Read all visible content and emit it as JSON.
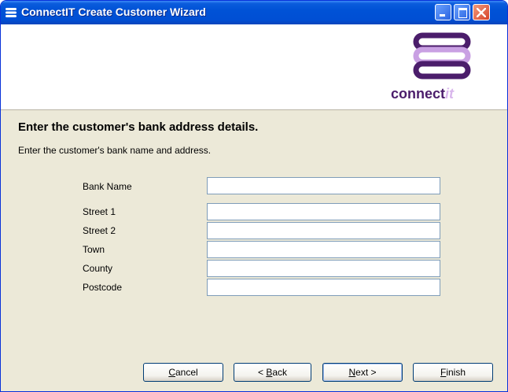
{
  "window": {
    "title": "ConnectIT Create Customer Wizard"
  },
  "logo": {
    "text_main": "connect",
    "text_accent": "it"
  },
  "page": {
    "heading": "Enter the customer's bank address details.",
    "subtext": "Enter the customer's bank name and address."
  },
  "form": {
    "bank_name_label": "Bank Name",
    "bank_name_value": "",
    "street1_label": "Street 1",
    "street1_value": "",
    "street2_label": "Street 2",
    "street2_value": "",
    "town_label": "Town",
    "town_value": "",
    "county_label": "County",
    "county_value": "",
    "postcode_label": "Postcode",
    "postcode_value": ""
  },
  "buttons": {
    "cancel_key": "C",
    "cancel_rest": "ancel",
    "back_prefix": "< ",
    "back_key": "B",
    "back_rest": "ack",
    "next_key": "N",
    "next_rest": "ext >",
    "finish_key": "F",
    "finish_rest": "inish"
  },
  "colors": {
    "titlebar": "#0052d6",
    "dialog_bg": "#ece9d8",
    "logo_purple": "#4b1d6b",
    "logo_light": "#d9b7ec"
  },
  "icons": {
    "title_icon": "app-stack-icon",
    "minimize": "minimize-icon",
    "maximize": "maximize-icon",
    "close": "close-icon"
  }
}
